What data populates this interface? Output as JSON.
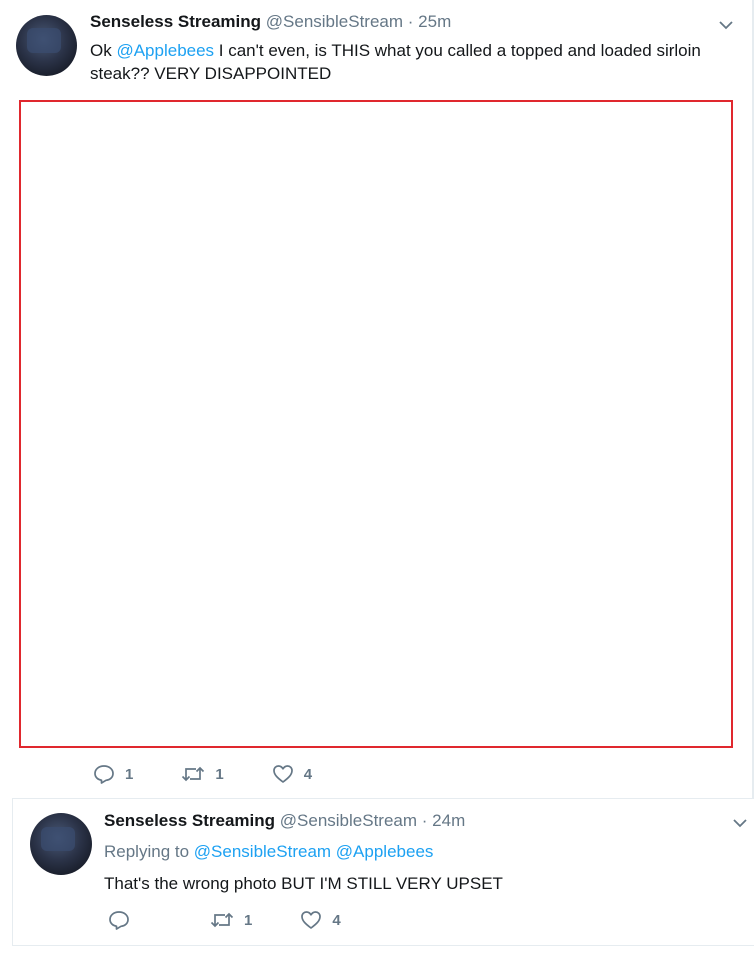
{
  "colors": {
    "link": "#1da1f2",
    "muted": "#657786",
    "text": "#14171a",
    "media_border": "#e0282e"
  },
  "tweet1": {
    "author_name": "Senseless Streaming",
    "author_handle": "@SensibleStream",
    "separator": "·",
    "time": "25m",
    "text_before": "Ok ",
    "mention": "@Applebees",
    "text_after": " I can't even, is THIS what you called a topped and loaded sirloin steak?? VERY DISAPPOINTED",
    "actions": {
      "reply_count": "1",
      "retweet_count": "1",
      "like_count": "4"
    },
    "icons": {
      "caret": "chevron-down-icon",
      "reply": "reply-icon",
      "retweet": "retweet-icon",
      "like": "heart-icon"
    }
  },
  "tweet2": {
    "author_name": "Senseless Streaming",
    "author_handle": "@SensibleStream",
    "separator": "·",
    "time": "24m",
    "replying_prefix": "Replying to",
    "replying_handle_1": "@SensibleStream",
    "replying_handle_2": "@Applebees",
    "text": "That's the wrong photo BUT I'M STILL VERY UPSET",
    "actions": {
      "reply_count": "",
      "retweet_count": "1",
      "like_count": "4"
    }
  }
}
